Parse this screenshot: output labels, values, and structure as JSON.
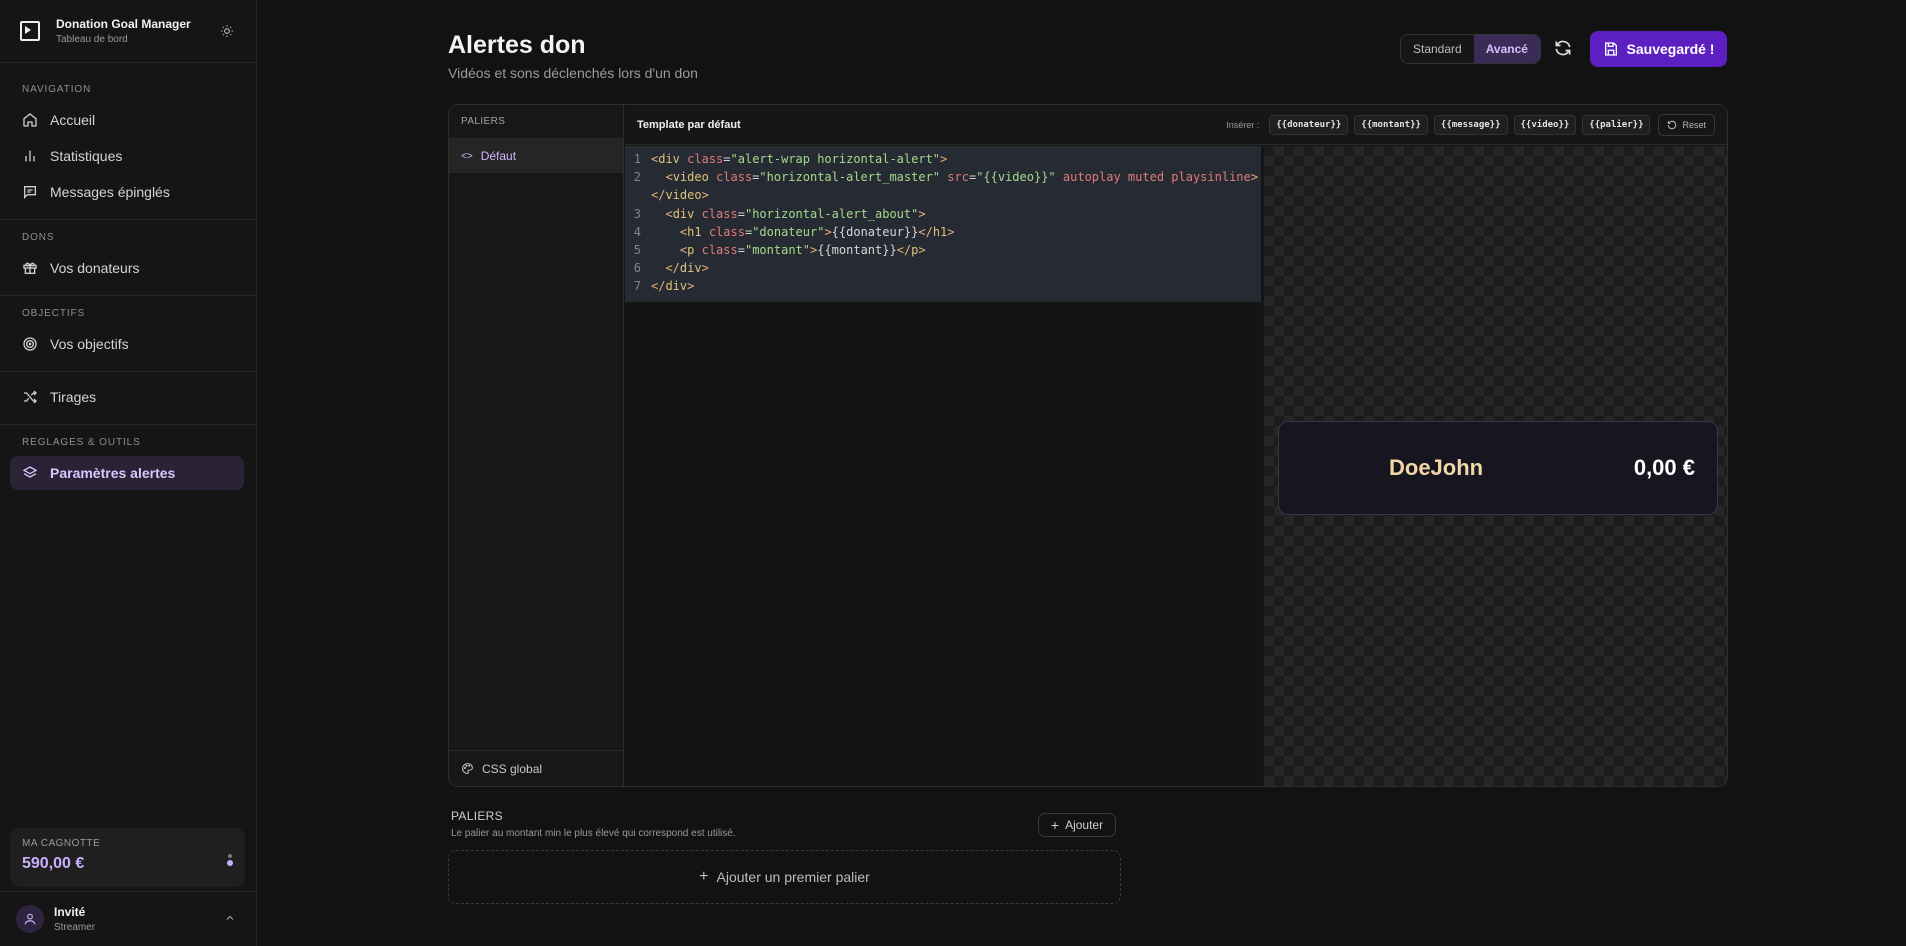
{
  "sidebar": {
    "app_title": "Donation Goal Manager",
    "app_subtitle": "Tableau de bord",
    "sections": {
      "navigation": "NAVIGATION",
      "dons": "DONS",
      "objectifs": "OBJECTIFS",
      "reglages": "REGLAGES & OUTILS"
    },
    "items": {
      "accueil": "Accueil",
      "statistiques": "Statistiques",
      "messages": "Messages épinglés",
      "donateurs": "Vos donateurs",
      "objectifs": "Vos objectifs",
      "tirages": "Tirages",
      "parametres": "Paramètres alertes"
    },
    "cagnotte_label": "MA CAGNOTTE",
    "cagnotte_value": "590,00 €",
    "user_name": "Invité",
    "user_role": "Streamer"
  },
  "header": {
    "title": "Alertes don",
    "subtitle": "Vidéos et sons déclenchés lors d'un don",
    "mode_standard": "Standard",
    "mode_avance": "Avancé",
    "save_label": "Sauvegardé !"
  },
  "editor": {
    "tiers_label": "PALIERS",
    "tier_default": "Défaut",
    "css_global": "CSS global",
    "template_title": "Template par défaut",
    "insert_label": "Insérer :",
    "chips": [
      "{{donateur}}",
      "{{montant}}",
      "{{message}}",
      "{{video}}",
      "{{palier}}"
    ],
    "reset": "Reset",
    "line_numbers": [
      "1",
      "2",
      "",
      "3",
      "4",
      "5",
      "6",
      "7"
    ]
  },
  "preview": {
    "donor": "DoeJohn",
    "amount": "0,00 €"
  },
  "paliers": {
    "title": "PALIERS",
    "subtitle": "Le palier au montant min le plus élevé qui correspond est utilisé.",
    "add": "Ajouter",
    "add_first": "Ajouter un premier palier"
  },
  "colors": {
    "accent": "#5b1fc2",
    "accent_light": "#c9b0ff",
    "donor_name": "#f2d7a6"
  }
}
